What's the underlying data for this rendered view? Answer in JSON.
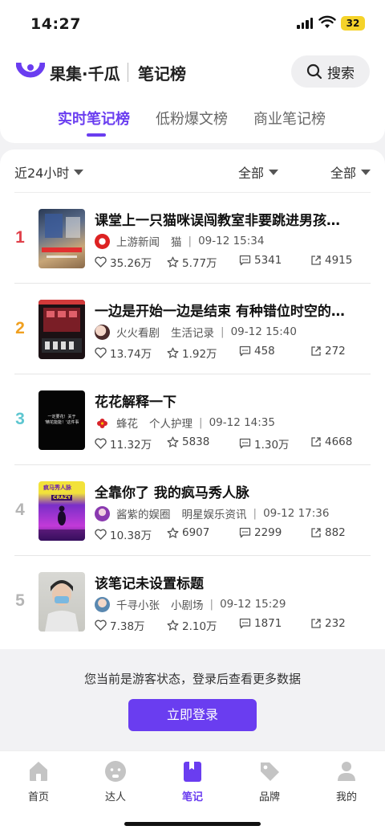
{
  "status_bar": {
    "time": "14:27",
    "battery": "32"
  },
  "header": {
    "brand": "果集·千瓜",
    "board_title": "笔记榜",
    "search_label": "搜索",
    "tabs": [
      {
        "label": "实时笔记榜",
        "active": true
      },
      {
        "label": "低粉爆文榜",
        "active": false
      },
      {
        "label": "商业笔记榜",
        "active": false
      }
    ]
  },
  "filters": {
    "time_range": "近24小时",
    "category": "全部",
    "type": "全部"
  },
  "notes": [
    {
      "rank": "1",
      "rank_color": "#e0404a",
      "title": "课堂上一只猫咪误闯教室非要跳进男孩…",
      "author": "上游新闻",
      "category": "猫",
      "time": "09-12 15:34",
      "likes": "35.26万",
      "favorites": "5.77万",
      "comments": "5341",
      "shares": "4915"
    },
    {
      "rank": "2",
      "rank_color": "#f0a020",
      "title": "一边是开始一边是结束 有种错位时空的…",
      "author": "火火看剧",
      "category": "生活记录",
      "time": "09-12 15:40",
      "likes": "13.74万",
      "favorites": "1.92万",
      "comments": "458",
      "shares": "272"
    },
    {
      "rank": "3",
      "rank_color": "#5ec6d0",
      "title": "花花解释一下",
      "author": "蜂花",
      "category": "个人护理",
      "time": "09-12 14:35",
      "likes": "11.32万",
      "favorites": "5838",
      "comments": "1.30万",
      "shares": "4668"
    },
    {
      "rank": "4",
      "rank_color": "#b5b5b5",
      "title": "全靠你了 我的疯马秀人脉",
      "author": "酱紫的娱圈",
      "category": "明星娱乐资讯",
      "time": "09-12 17:36",
      "likes": "10.38万",
      "favorites": "6907",
      "comments": "2299",
      "shares": "882"
    },
    {
      "rank": "5",
      "rank_color": "#b5b5b5",
      "title": "该笔记未设置标题",
      "author": "千寻小张",
      "category": "小剧场",
      "time": "09-12 15:29",
      "likes": "7.38万",
      "favorites": "2.10万",
      "comments": "1871",
      "shares": "232"
    }
  ],
  "thumbnail_text": {
    "note3": "一定要花！关于\n'精花能能！'这件事",
    "note4_top": "疯马秀人脉",
    "note4_mid": "CRAZY"
  },
  "guest_banner": {
    "text": "您当前是游客状态，登录后查看更多数据",
    "login_label": "立即登录"
  },
  "bottom_nav": [
    {
      "label": "首页",
      "icon": "home-icon",
      "active": false
    },
    {
      "label": "达人",
      "icon": "influencer-icon",
      "active": false
    },
    {
      "label": "笔记",
      "icon": "notes-icon",
      "active": true
    },
    {
      "label": "品牌",
      "icon": "brand-tag-icon",
      "active": false
    },
    {
      "label": "我的",
      "icon": "profile-icon",
      "active": false
    }
  ],
  "colors": {
    "accent": "#6a3df0",
    "rank1": "#e0404a",
    "rank2": "#f0a020",
    "rank3": "#5ec6d0",
    "rank_other": "#b5b5b5"
  }
}
